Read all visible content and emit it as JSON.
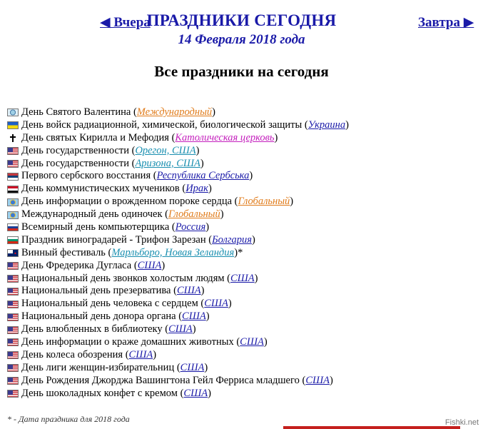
{
  "header": {
    "prev_label": "◀ Вчера",
    "next_label": "Завтра ▶",
    "title": "ПРАЗДНИКИ СЕГОДНЯ",
    "date": "14 Февраля 2018 года",
    "subtitle": "Все праздники на сегодня"
  },
  "colors": {
    "link_blue": "#1a1aa8",
    "international": "#e07b1a",
    "catholic": "#c41fbd",
    "teal": "#1a8fb0"
  },
  "holidays": [
    {
      "icon": "world-flag-icon",
      "flag": "world",
      "name": "День Святого Валентина",
      "region": "Международный",
      "color": "#e07b1a",
      "suffix": ""
    },
    {
      "icon": "ukraine-flag-icon",
      "flag": "ua",
      "name": "День войск радиационной, химической, биологической защиты",
      "region": "Украина",
      "color": "#1a1aa8",
      "suffix": ""
    },
    {
      "icon": "cross-icon",
      "flag": "cross",
      "name": "День святых Кирилла и Мефодия",
      "region": "Католическая церковь",
      "color": "#c41fbd",
      "suffix": ""
    },
    {
      "icon": "usa-flag-icon",
      "flag": "us",
      "name": "День государственности",
      "region": "Орегон, США",
      "color": "#1a8fb0",
      "suffix": ""
    },
    {
      "icon": "usa-flag-icon",
      "flag": "us",
      "name": "День государственности",
      "region": "Аризона, США",
      "color": "#1a8fb0",
      "suffix": ""
    },
    {
      "icon": "serbia-flag-icon",
      "flag": "rs",
      "name": "Первого сербского восстания",
      "region": "Республика Сербська",
      "color": "#1a1aa8",
      "suffix": ""
    },
    {
      "icon": "iraq-flag-icon",
      "flag": "iq",
      "name": "День коммунистических мучеников",
      "region": "Ирак",
      "color": "#1a1aa8",
      "suffix": ""
    },
    {
      "icon": "globe-icon",
      "flag": "globe",
      "name": "День информации о врожденном пороке сердца",
      "region": "Глобальный",
      "color": "#e07b1a",
      "suffix": ""
    },
    {
      "icon": "globe-icon",
      "flag": "globe",
      "name": "Международный день одиночек",
      "region": "Глобальный",
      "color": "#e07b1a",
      "suffix": ""
    },
    {
      "icon": "russia-flag-icon",
      "flag": "ru",
      "name": "Всемирный день компьютерщика",
      "region": "Россия",
      "color": "#1a1aa8",
      "suffix": ""
    },
    {
      "icon": "bulgaria-flag-icon",
      "flag": "bg",
      "name": "Праздник виноградарей - Трифон Зарезан",
      "region": "Болгария",
      "color": "#1a1aa8",
      "suffix": ""
    },
    {
      "icon": "new-zealand-flag-icon",
      "flag": "nz",
      "name": "Винный фестиваль",
      "region": "Марльборо, Новая Зеландия",
      "color": "#1a8fb0",
      "suffix": "*"
    },
    {
      "icon": "usa-flag-icon",
      "flag": "us",
      "name": "День Фредерика Дугласа",
      "region": "США",
      "color": "#1a1aa8",
      "suffix": ""
    },
    {
      "icon": "usa-flag-icon",
      "flag": "us",
      "name": "Национальный день звонков холостым людям",
      "region": "США",
      "color": "#1a1aa8",
      "suffix": ""
    },
    {
      "icon": "usa-flag-icon",
      "flag": "us",
      "name": "Национальный день презерватива",
      "region": "США",
      "color": "#1a1aa8",
      "suffix": ""
    },
    {
      "icon": "usa-flag-icon",
      "flag": "us",
      "name": "Национальный день человека с сердцем",
      "region": "США",
      "color": "#1a1aa8",
      "suffix": ""
    },
    {
      "icon": "usa-flag-icon",
      "flag": "us",
      "name": "Национальный день донора органа",
      "region": "США",
      "color": "#1a1aa8",
      "suffix": ""
    },
    {
      "icon": "usa-flag-icon",
      "flag": "us",
      "name": "День влюбленных в библиотеку",
      "region": "США",
      "color": "#1a1aa8",
      "suffix": ""
    },
    {
      "icon": "usa-flag-icon",
      "flag": "us",
      "name": "День информации о краже домашних животных",
      "region": "США",
      "color": "#1a1aa8",
      "suffix": ""
    },
    {
      "icon": "usa-flag-icon",
      "flag": "us",
      "name": "День колеса обозрения",
      "region": "США",
      "color": "#1a1aa8",
      "suffix": ""
    },
    {
      "icon": "usa-flag-icon",
      "flag": "us",
      "name": "День лиги женщин-избирательниц",
      "region": "США",
      "color": "#1a1aa8",
      "suffix": ""
    },
    {
      "icon": "usa-flag-icon",
      "flag": "us",
      "name": "День Рождения Джорджа Вашингтона Гейл Ферриса младшего",
      "region": "США",
      "color": "#1a1aa8",
      "suffix": ""
    },
    {
      "icon": "usa-flag-icon",
      "flag": "us",
      "name": "День шоколадных конфет с кремом",
      "region": "США",
      "color": "#1a1aa8",
      "suffix": ""
    }
  ],
  "footnote": "* - Дата праздника для 2018 года",
  "watermark": "Fishki.net"
}
